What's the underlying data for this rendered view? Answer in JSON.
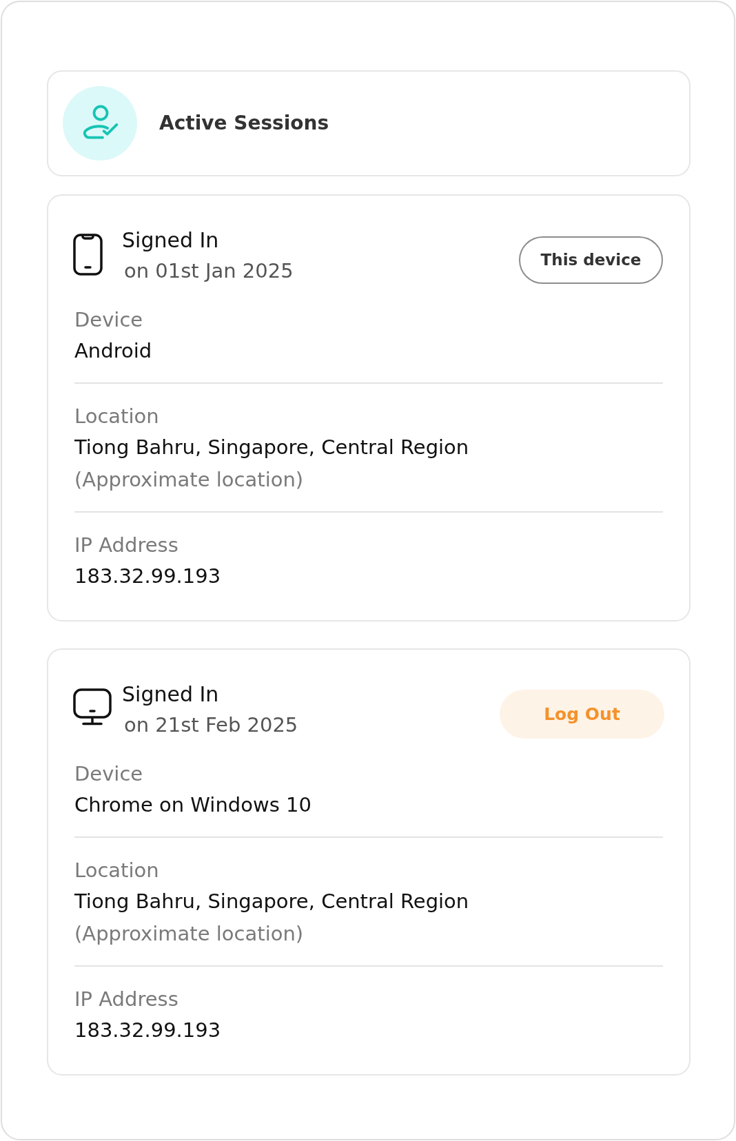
{
  "header": {
    "title": "Active Sessions"
  },
  "sessions": [
    {
      "kind": "mobile",
      "status": "Signed In",
      "date": "on 01st Jan 2025",
      "action": {
        "kind": "current",
        "label": "This device"
      },
      "fields": [
        {
          "label": "Device",
          "value": "Android"
        },
        {
          "label": "Location",
          "value": "Tiong Bahru, Singapore, Central Region",
          "note": "(Approximate location)"
        },
        {
          "label": "IP Address",
          "value": "183.32.99.193"
        }
      ]
    },
    {
      "kind": "desktop",
      "status": "Signed In",
      "date": "on 21st Feb 2025",
      "action": {
        "kind": "logout",
        "label": "Log Out"
      },
      "fields": [
        {
          "label": "Device",
          "value": "Chrome on Windows 10"
        },
        {
          "label": "Location",
          "value": "Tiong Bahru, Singapore, Central Region",
          "note": "(Approximate location)"
        },
        {
          "label": "IP Address",
          "value": "183.32.99.193"
        }
      ]
    }
  ]
}
